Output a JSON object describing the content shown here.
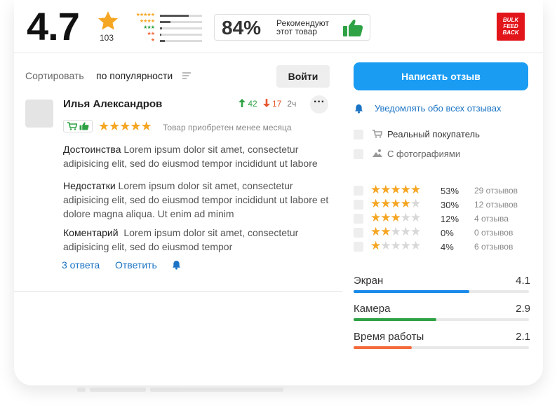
{
  "summary": {
    "rating": "4.7",
    "review_count": "103",
    "rating_distribution": [
      {
        "stars": 5,
        "fraction": 0.68
      },
      {
        "stars": 4,
        "fraction": 0.25
      },
      {
        "stars": 3,
        "fraction": 0.05
      },
      {
        "stars": 2,
        "fraction": 0.03
      },
      {
        "stars": 1,
        "fraction": 0.12
      }
    ],
    "recommend_percent": "84%",
    "recommend_text": "Рекомендуют этот товар",
    "logo_text": [
      "BULK",
      "FEED",
      "BACK"
    ]
  },
  "toolbar": {
    "sort_label": "Сортировать",
    "sort_value": "по популярности",
    "login_label": "Войти"
  },
  "review": {
    "author": "Илья Александров",
    "upvotes": "42",
    "downvotes": "17",
    "time": "2ч",
    "rating": 5,
    "purchase_note": "Товар приобретен менее месяца",
    "pros_label": "Достоинства",
    "pros_text": "Lorem ipsum dolor sit amet, consectetur adipisicing elit, sed do eiusmod tempor incididunt ut labore",
    "cons_label": "Недостатки",
    "cons_text": "Lorem ipsum dolor sit amet, consectetur adipisicing elit, sed do eiusmod tempor incididunt ut labore et dolore magna aliqua. Ut enim ad minim",
    "comment_label": "Коментарий",
    "comment_text": "Lorem ipsum dolor sit amet, consectetur adipisicing elit, sed do eiusmod tempor",
    "replies_label": "3 ответа",
    "reply_label": "Ответить"
  },
  "sidebar": {
    "write_review_label": "Написать отзыв",
    "notify_label": "Уведомлять обо всех отзывах",
    "filters": [
      {
        "label": "Реальный покупатель",
        "icon": "cart-icon"
      },
      {
        "label": "С фотографиями",
        "icon": "photo-icon"
      }
    ],
    "distribution": [
      {
        "stars": 5,
        "percent": "53%",
        "count": "29 отзывов"
      },
      {
        "stars": 4,
        "percent": "30%",
        "count": "12 отзывов"
      },
      {
        "stars": 3,
        "percent": "12%",
        "count": "4 отзыва"
      },
      {
        "stars": 2,
        "percent": "0%",
        "count": "0 отзывов"
      },
      {
        "stars": 1,
        "percent": "4%",
        "count": "6 отзывов"
      }
    ],
    "attributes": [
      {
        "name": "Экран",
        "value": "4.1",
        "fill": 0.66,
        "color": "#1a8ae8"
      },
      {
        "name": "Камера",
        "value": "2.9",
        "fill": 0.47,
        "color": "#2ea244"
      },
      {
        "name": "Время работы",
        "value": "2.1",
        "fill": 0.33,
        "color": "#f36b3c"
      }
    ]
  },
  "colors": {
    "accent": "#1a9cf3",
    "star": "#f5a623",
    "up": "#2ea244",
    "down": "#e6562c",
    "brand_red": "#e2151a"
  }
}
